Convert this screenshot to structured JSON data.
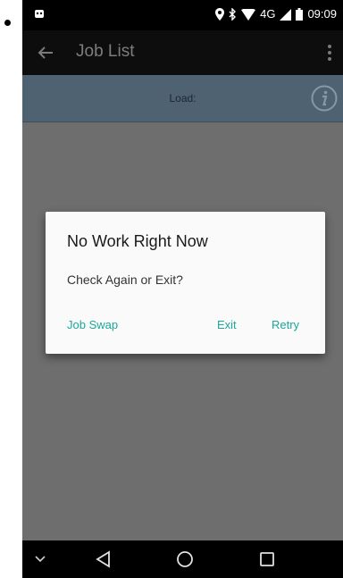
{
  "status_bar": {
    "network": "4G",
    "time": "09:09"
  },
  "app_bar": {
    "title": "Job List"
  },
  "load_bar": {
    "label": "Load:"
  },
  "dialog": {
    "title": "No Work Right Now",
    "message": "Check Again or Exit?",
    "buttons": {
      "job_swap": "Job Swap",
      "exit": "Exit",
      "retry": "Retry"
    }
  },
  "colors": {
    "accent": "#1aa89a",
    "load_bar": "#4f6272",
    "scrim": "#6e6e6e"
  }
}
